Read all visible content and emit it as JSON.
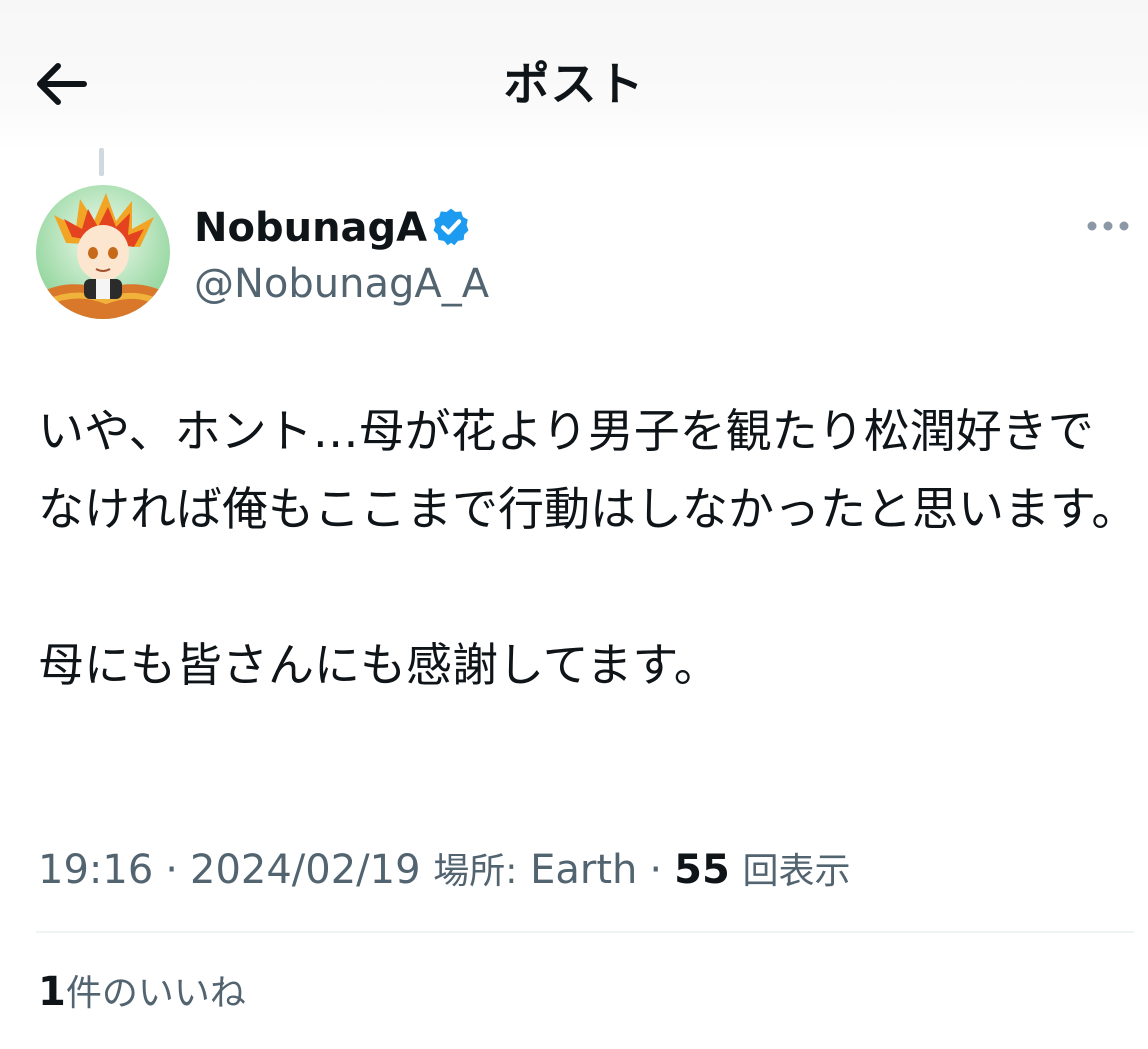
{
  "header": {
    "title": "ポスト",
    "back_icon": "arrow-left-icon"
  },
  "author": {
    "display_name": "NobunagA",
    "handle": "@NobunagA_A",
    "verified_icon": "verified-badge-icon",
    "verified_color": "#1d9bf0"
  },
  "tweet": {
    "paragraphs": [
      "いや、ホント…母が花より男子を観たり松潤好きでなければ俺もここまで行動はしなかったと思います。",
      "母にも皆さんにも感謝してます。"
    ]
  },
  "meta": {
    "time": "19:16",
    "separator": "·",
    "date": "2024/02/19",
    "location_label": "場所:",
    "location": "Earth",
    "views_count": "55",
    "views_label": "回表示"
  },
  "likes": {
    "count": "1",
    "label": "件のいいね"
  },
  "colors": {
    "text_primary": "#0f1419",
    "text_secondary": "#536471",
    "accent": "#1d9bf0",
    "divider": "#eff3f4"
  }
}
